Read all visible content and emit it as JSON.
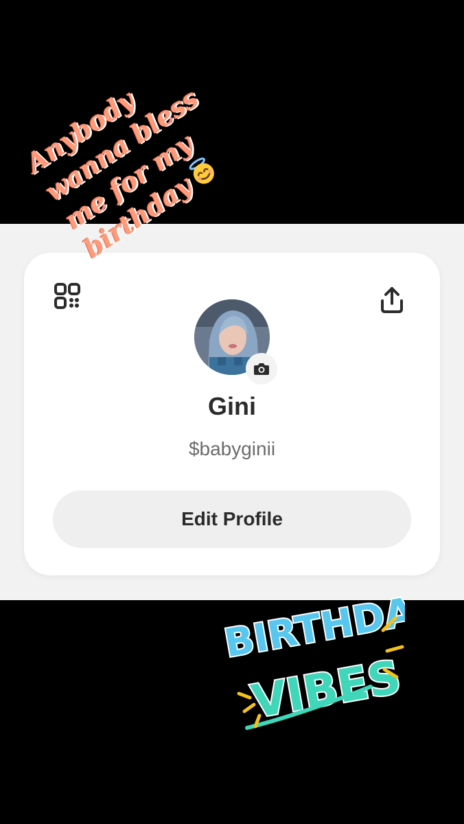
{
  "story_caption": {
    "lines": [
      "Anybody",
      "wanna bless",
      "me for my",
      "birthday"
    ],
    "emoji_icon": "smiling-face-with-halo-icon"
  },
  "profile": {
    "name": "Gini",
    "cashtag": "$babyginii",
    "edit_label": "Edit Profile"
  },
  "icons": {
    "qr": "qr-code-icon",
    "share": "share-icon",
    "camera": "camera-icon"
  },
  "sticker": {
    "line1": "BIRTHDAY",
    "line2": "VIBES"
  },
  "colors": {
    "caption": "#ff9a7a",
    "card": "#ffffff",
    "button": "#efefef"
  }
}
